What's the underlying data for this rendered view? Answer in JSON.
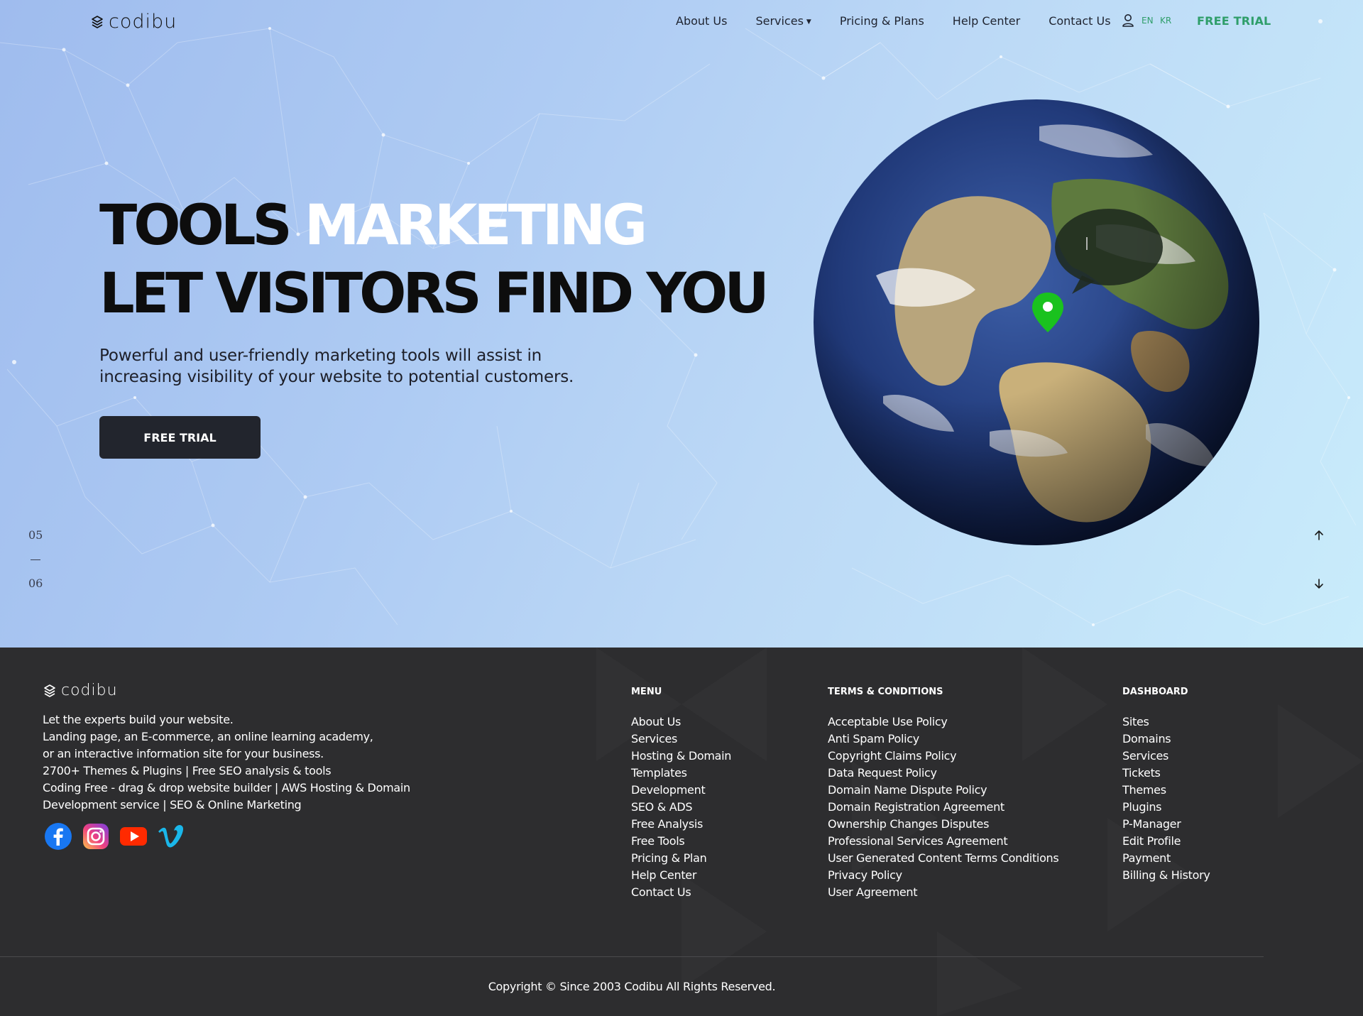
{
  "brand": {
    "name": "codibu"
  },
  "nav": {
    "links": [
      "About Us",
      "Services",
      "Pricing & Plans",
      "Help Center",
      "Contact Us"
    ],
    "lang_en": "EN",
    "lang_kr": "KR",
    "trial": "FREE TRIAL"
  },
  "hero": {
    "headline_black_1": "TOOLS",
    "headline_white": "MARKETING",
    "headline_line2": "LET VISITORS FIND YOU",
    "subtext": "Powerful and user-friendly marketing tools will assist in increasing visibility of your website to potential customers.",
    "cta": "FREE TRIAL",
    "slide_current": "05",
    "slide_total": "06"
  },
  "footer": {
    "description": [
      "Let the experts build your website.",
      "Landing page, an E-commerce, an online learning academy,",
      "or an interactive information site for your business.",
      "2700+ Themes & Plugins | Free SEO analysis & tools",
      "Coding Free - drag & drop website builder | AWS Hosting & Domain",
      "Development service | SEO & Online Marketing"
    ],
    "socials": [
      "facebook-icon",
      "instagram-icon",
      "youtube-icon",
      "vimeo-icon"
    ],
    "menu": {
      "title": "MENU",
      "items": [
        "About Us",
        "Services",
        "Hosting & Domain",
        "Templates",
        "Development",
        "SEO & ADS",
        "Free Analysis",
        "Free Tools",
        "Pricing & Plan",
        "Help Center",
        "Contact Us"
      ]
    },
    "terms": {
      "title": "TERMS & CONDITIONS",
      "items": [
        "Acceptable Use Policy",
        "Anti Spam Policy",
        "Copyright Claims Policy",
        "Data Request Policy",
        "Domain Name Dispute Policy",
        "Domain Registration Agreement",
        "Ownership Changes Disputes",
        "Professional Services Agreement",
        "User Generated Content Terms Conditions",
        "Privacy Policy",
        "User Agreement"
      ]
    },
    "dashboard": {
      "title": "DASHBOARD",
      "items": [
        "Sites",
        "Domains",
        "Services",
        "Tickets",
        "Themes",
        "Plugins",
        "P-Manager",
        "Edit Profile",
        "Payment",
        "Billing & History"
      ]
    },
    "copyright": "Copyright © Since 2003 Codibu All Rights Reserved."
  },
  "colors": {
    "accent_green": "#2f9e6a",
    "dark_button": "#22252d",
    "footer_bg": "#2d2d2f"
  }
}
